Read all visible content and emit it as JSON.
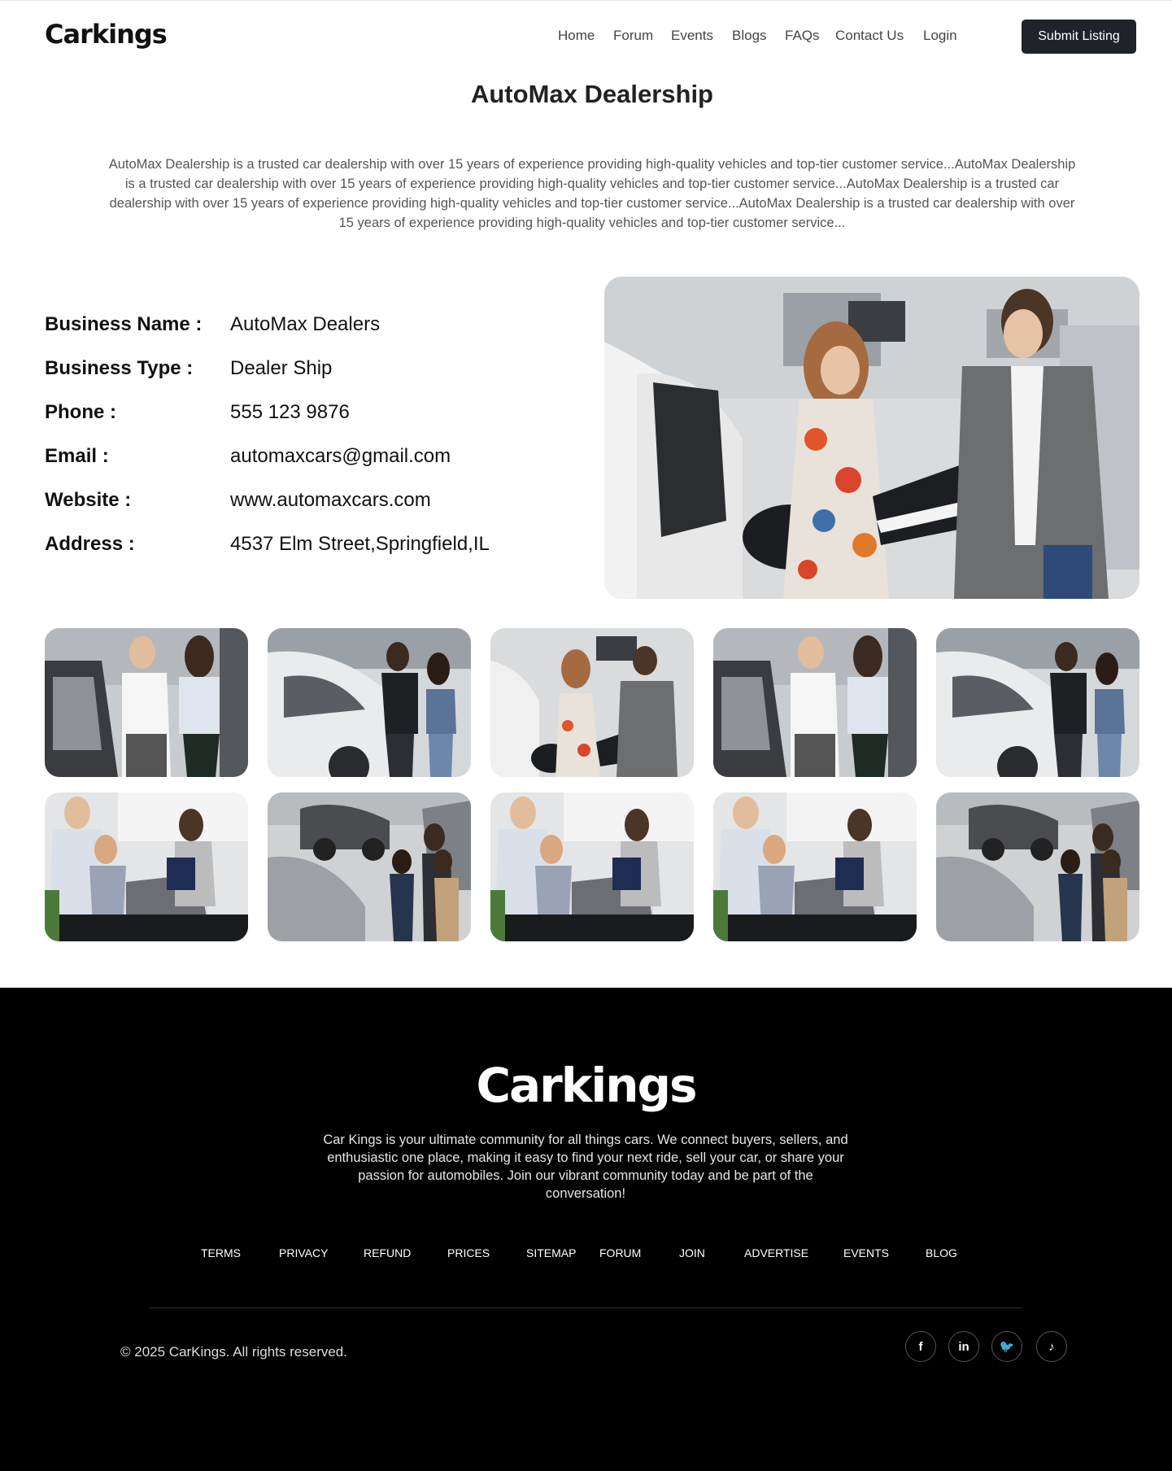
{
  "header": {
    "logo": "Carkings",
    "nav": [
      "Home",
      "Forum",
      "Events",
      "Blogs",
      "FAQs",
      "Contact Us",
      "Login"
    ],
    "submit_label": "Submit Listing"
  },
  "page": {
    "title": "AutoMax Dealership",
    "description": "AutoMax Dealership is a trusted car dealership with over 15 years of experience providing high-quality vehicles and top-tier customer service...AutoMax Dealership is a trusted car dealership with over 15 years of experience providing high-quality vehicles and top-tier customer service...AutoMax Dealership is a trusted car dealership with over 15 years of experience providing high-quality vehicles and top-tier customer service...AutoMax Dealership is a trusted car dealership with over 15 years of experience providing high-quality vehicles and top-tier customer service..."
  },
  "details": [
    {
      "label": "Business Name  :",
      "value": "AutoMax Dealers"
    },
    {
      "label": "Business Type :",
      "value": "Dealer Ship"
    },
    {
      "label": "Phone :",
      "value": "555 123 9876"
    },
    {
      "label": "Email :",
      "value": "automaxcars@gmail.com"
    },
    {
      "label": "Website :",
      "value": "www.automaxcars.com"
    },
    {
      "label": "Address :",
      "value": "4537 Elm Street,Springfield,IL"
    }
  ],
  "footer": {
    "logo": "Carkings",
    "description": "Car Kings is your ultimate community for all things cars. We connect buyers, sellers, and enthusiastic one place, making it easy to find your next ride, sell your car, or share your passion for automobiles. Join our vibrant community today and be part of the conversation!",
    "links": [
      "TERMS",
      "PRIVACY",
      "REFUND",
      "PRICES",
      "SITEMAP",
      "FORUM",
      "JOIN",
      "ADVERTISE",
      "EVENTS",
      "BLOG"
    ],
    "copyright": "© 2025 CarKings. All rights reserved.",
    "socials": [
      {
        "icon": "facebook-icon",
        "glyph": "f"
      },
      {
        "icon": "linkedin-icon",
        "glyph": "in"
      },
      {
        "icon": "twitter-icon",
        "glyph": "🐦"
      },
      {
        "icon": "tiktok-icon",
        "glyph": "♪"
      }
    ]
  },
  "colors": {
    "button_bg": "#202328",
    "footer_bg": "#000000"
  }
}
